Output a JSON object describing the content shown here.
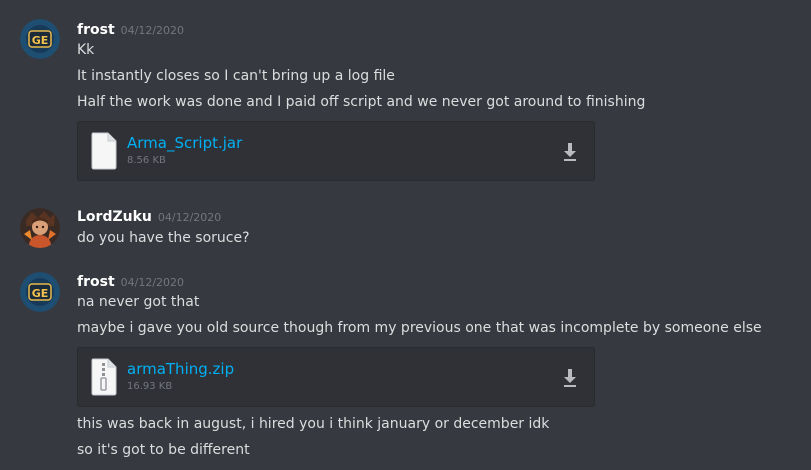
{
  "messages": [
    {
      "author": "frost",
      "timestamp": "04/12/2020",
      "avatar_text": "GE",
      "lines": [
        "Kk",
        "It instantly closes so I can't bring up a log file",
        "Half the work was done and I paid off script and we never got around to finishing"
      ],
      "attachment": {
        "name": "Arma_Script.jar",
        "size": "8.56 KB",
        "icon": "document-icon"
      }
    },
    {
      "author": "LordZuku",
      "timestamp": "04/12/2020",
      "lines": [
        "do you have the soruce?"
      ]
    },
    {
      "author": "frost",
      "timestamp": "04/12/2020",
      "avatar_text": "GE",
      "lines": [
        "na never got that",
        "maybe i gave you old source though from my previous one that was incomplete by someone else"
      ],
      "attachment": {
        "name": "armaThing.zip",
        "size": "16.93 KB",
        "icon": "archive-icon"
      },
      "after_lines": [
        "this was back in august, i hired you i think january or december idk",
        "so it's got to be different"
      ]
    }
  ],
  "colors": {
    "background": "#36393f",
    "attachment_bg": "#2f3136",
    "link": "#00b0f4",
    "muted": "#72767d",
    "text": "#dcddde"
  }
}
